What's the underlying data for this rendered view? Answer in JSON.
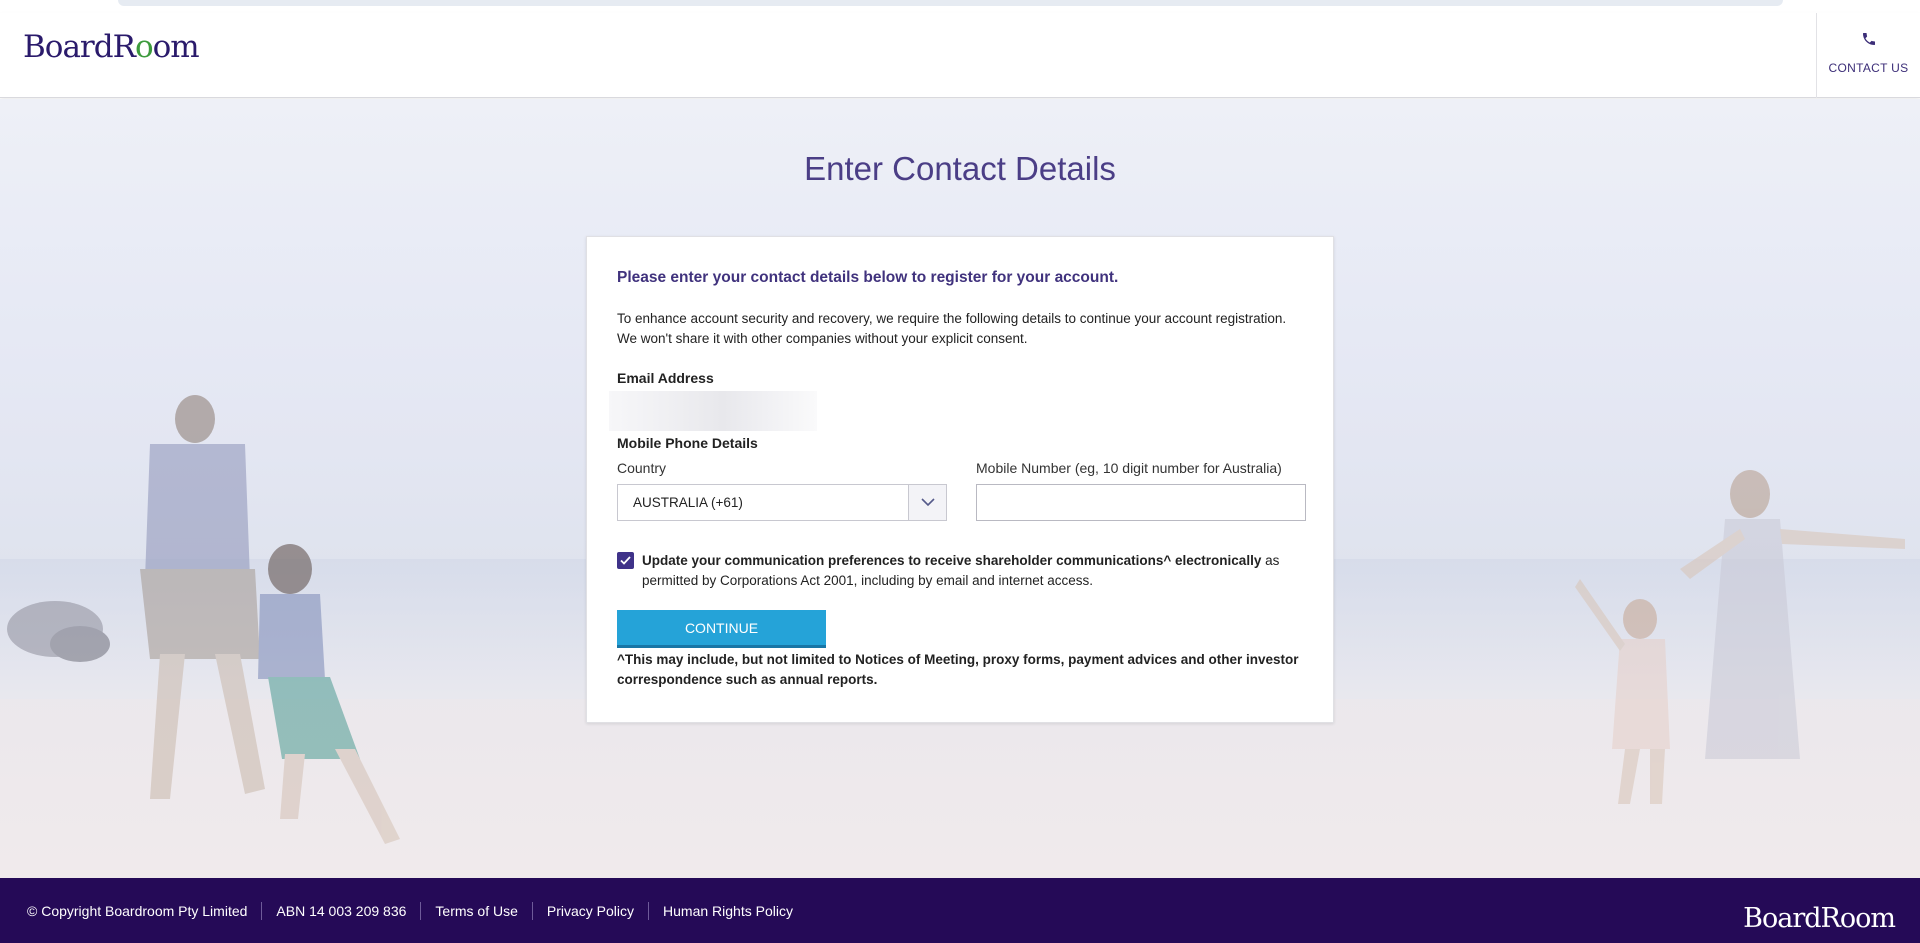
{
  "header": {
    "logo_text_a": "BoardR",
    "logo_text_b": "o",
    "logo_text_c": "om",
    "contact_label": "CONTACT US",
    "contact_icon": "phone-icon"
  },
  "page": {
    "title": "Enter Contact Details"
  },
  "form": {
    "intro": "Please enter your contact details below to register for your account.",
    "description_line1": "To enhance account security and recovery, we require the following details to continue your account registration.",
    "description_line2": "We won't share it with other companies without your explicit consent.",
    "email_label": "Email Address",
    "phone_section_label": "Mobile Phone Details",
    "country_label": "Country",
    "country_value": "AUSTRALIA (+61)",
    "mobile_label": "Mobile Number (eg, 10 digit number for Australia)",
    "mobile_value": "",
    "consent_checked": true,
    "consent_bold": "Update your communication preferences to receive shareholder communications^ electronically",
    "consent_rest": " as permitted by Corporations Act 2001, including by email and internet access.",
    "continue_label": "CONTINUE",
    "footnote": "^This may include, but not limited to Notices of Meeting, proxy forms, payment advices and other investor correspondence such as annual reports."
  },
  "footer": {
    "copyright": "© Copyright Boardroom Pty Limited",
    "abn": "ABN 14 003 209 836",
    "terms": "Terms of Use",
    "privacy": "Privacy Policy",
    "human_rights": "Human Rights Policy",
    "logo_text": "BoardRoom"
  },
  "colors": {
    "brand_purple": "#250a57",
    "accent_purple": "#40327d",
    "button_blue": "#25a3d8"
  }
}
